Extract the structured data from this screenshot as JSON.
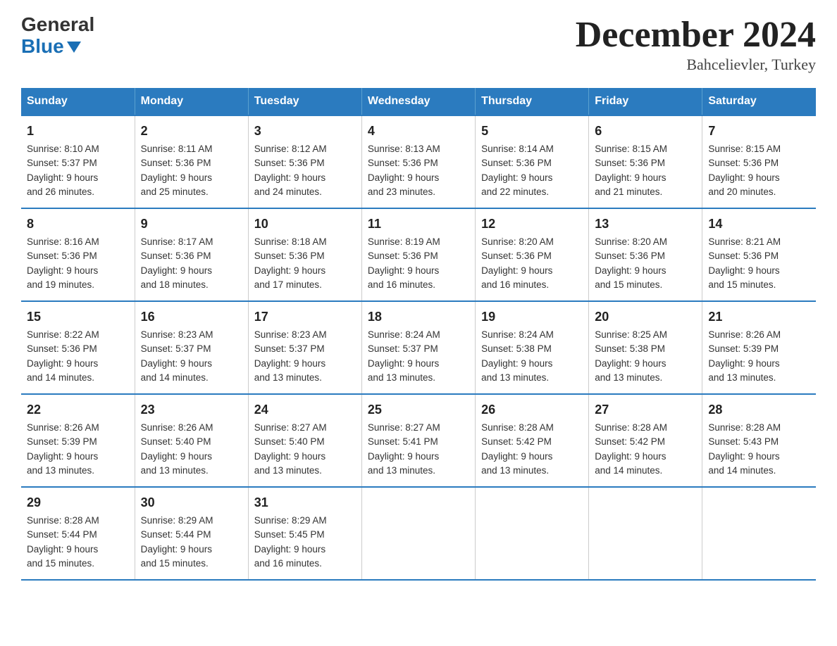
{
  "header": {
    "logo_general": "General",
    "logo_blue": "Blue",
    "month_title": "December 2024",
    "location": "Bahcelievler, Turkey"
  },
  "days_of_week": [
    "Sunday",
    "Monday",
    "Tuesday",
    "Wednesday",
    "Thursday",
    "Friday",
    "Saturday"
  ],
  "weeks": [
    [
      {
        "day": "1",
        "sunrise": "8:10 AM",
        "sunset": "5:37 PM",
        "daylight": "9 hours and 26 minutes."
      },
      {
        "day": "2",
        "sunrise": "8:11 AM",
        "sunset": "5:36 PM",
        "daylight": "9 hours and 25 minutes."
      },
      {
        "day": "3",
        "sunrise": "8:12 AM",
        "sunset": "5:36 PM",
        "daylight": "9 hours and 24 minutes."
      },
      {
        "day": "4",
        "sunrise": "8:13 AM",
        "sunset": "5:36 PM",
        "daylight": "9 hours and 23 minutes."
      },
      {
        "day": "5",
        "sunrise": "8:14 AM",
        "sunset": "5:36 PM",
        "daylight": "9 hours and 22 minutes."
      },
      {
        "day": "6",
        "sunrise": "8:15 AM",
        "sunset": "5:36 PM",
        "daylight": "9 hours and 21 minutes."
      },
      {
        "day": "7",
        "sunrise": "8:15 AM",
        "sunset": "5:36 PM",
        "daylight": "9 hours and 20 minutes."
      }
    ],
    [
      {
        "day": "8",
        "sunrise": "8:16 AM",
        "sunset": "5:36 PM",
        "daylight": "9 hours and 19 minutes."
      },
      {
        "day": "9",
        "sunrise": "8:17 AM",
        "sunset": "5:36 PM",
        "daylight": "9 hours and 18 minutes."
      },
      {
        "day": "10",
        "sunrise": "8:18 AM",
        "sunset": "5:36 PM",
        "daylight": "9 hours and 17 minutes."
      },
      {
        "day": "11",
        "sunrise": "8:19 AM",
        "sunset": "5:36 PM",
        "daylight": "9 hours and 16 minutes."
      },
      {
        "day": "12",
        "sunrise": "8:20 AM",
        "sunset": "5:36 PM",
        "daylight": "9 hours and 16 minutes."
      },
      {
        "day": "13",
        "sunrise": "8:20 AM",
        "sunset": "5:36 PM",
        "daylight": "9 hours and 15 minutes."
      },
      {
        "day": "14",
        "sunrise": "8:21 AM",
        "sunset": "5:36 PM",
        "daylight": "9 hours and 15 minutes."
      }
    ],
    [
      {
        "day": "15",
        "sunrise": "8:22 AM",
        "sunset": "5:36 PM",
        "daylight": "9 hours and 14 minutes."
      },
      {
        "day": "16",
        "sunrise": "8:23 AM",
        "sunset": "5:37 PM",
        "daylight": "9 hours and 14 minutes."
      },
      {
        "day": "17",
        "sunrise": "8:23 AM",
        "sunset": "5:37 PM",
        "daylight": "9 hours and 13 minutes."
      },
      {
        "day": "18",
        "sunrise": "8:24 AM",
        "sunset": "5:37 PM",
        "daylight": "9 hours and 13 minutes."
      },
      {
        "day": "19",
        "sunrise": "8:24 AM",
        "sunset": "5:38 PM",
        "daylight": "9 hours and 13 minutes."
      },
      {
        "day": "20",
        "sunrise": "8:25 AM",
        "sunset": "5:38 PM",
        "daylight": "9 hours and 13 minutes."
      },
      {
        "day": "21",
        "sunrise": "8:26 AM",
        "sunset": "5:39 PM",
        "daylight": "9 hours and 13 minutes."
      }
    ],
    [
      {
        "day": "22",
        "sunrise": "8:26 AM",
        "sunset": "5:39 PM",
        "daylight": "9 hours and 13 minutes."
      },
      {
        "day": "23",
        "sunrise": "8:26 AM",
        "sunset": "5:40 PM",
        "daylight": "9 hours and 13 minutes."
      },
      {
        "day": "24",
        "sunrise": "8:27 AM",
        "sunset": "5:40 PM",
        "daylight": "9 hours and 13 minutes."
      },
      {
        "day": "25",
        "sunrise": "8:27 AM",
        "sunset": "5:41 PM",
        "daylight": "9 hours and 13 minutes."
      },
      {
        "day": "26",
        "sunrise": "8:28 AM",
        "sunset": "5:42 PM",
        "daylight": "9 hours and 13 minutes."
      },
      {
        "day": "27",
        "sunrise": "8:28 AM",
        "sunset": "5:42 PM",
        "daylight": "9 hours and 14 minutes."
      },
      {
        "day": "28",
        "sunrise": "8:28 AM",
        "sunset": "5:43 PM",
        "daylight": "9 hours and 14 minutes."
      }
    ],
    [
      {
        "day": "29",
        "sunrise": "8:28 AM",
        "sunset": "5:44 PM",
        "daylight": "9 hours and 15 minutes."
      },
      {
        "day": "30",
        "sunrise": "8:29 AM",
        "sunset": "5:44 PM",
        "daylight": "9 hours and 15 minutes."
      },
      {
        "day": "31",
        "sunrise": "8:29 AM",
        "sunset": "5:45 PM",
        "daylight": "9 hours and 16 minutes."
      },
      null,
      null,
      null,
      null
    ]
  ],
  "labels": {
    "sunrise": "Sunrise:",
    "sunset": "Sunset:",
    "daylight": "Daylight:"
  }
}
